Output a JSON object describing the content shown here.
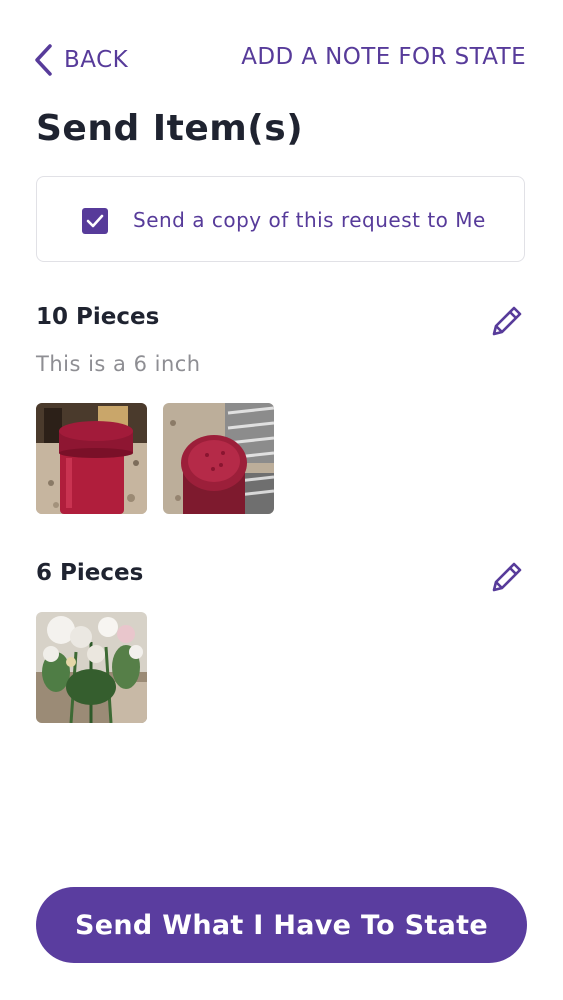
{
  "header": {
    "back_label": "BACK",
    "back_icon": "chevron-left-icon",
    "note_label": "ADD A NOTE FOR STATE"
  },
  "page": {
    "title": "Send Item(s)"
  },
  "copy_option": {
    "label": "Send a copy of this request to Me",
    "checked": true
  },
  "groups": [
    {
      "title": "10 Pieces",
      "description": "This is a 6 inch",
      "edit_icon": "pencil-icon",
      "photos": [
        "red-jar-photo",
        "red-jar-top-photo"
      ]
    },
    {
      "title": "6 Pieces",
      "description": "",
      "edit_icon": "pencil-icon",
      "photos": [
        "flowers-photo"
      ]
    }
  ],
  "footer": {
    "send_label": "Send What I Have To State"
  },
  "colors": {
    "accent": "#573b9a",
    "button": "#5a3d9f",
    "title": "#1f2330",
    "muted": "#8e8e93"
  }
}
